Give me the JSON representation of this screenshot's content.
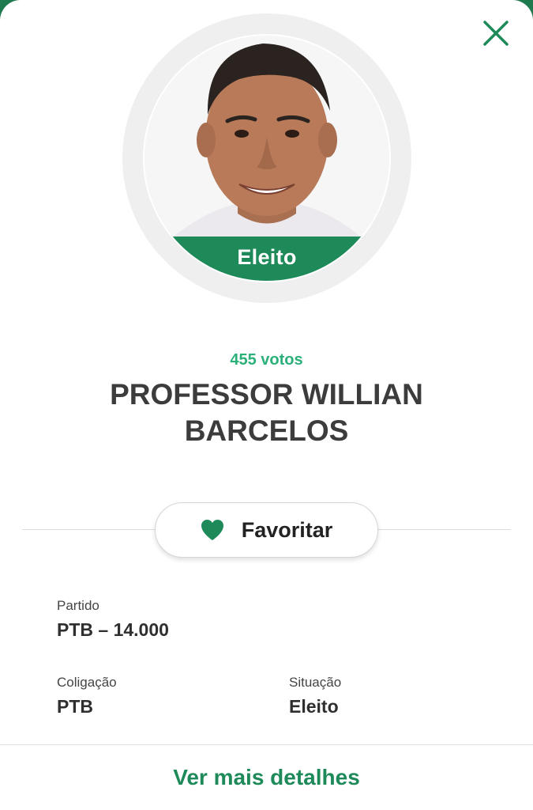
{
  "header": {
    "close_icon": "close-icon"
  },
  "candidate": {
    "status_badge": "Eleito",
    "votes": "455 votos",
    "name": "PROFESSOR WILLIAN BARCELOS"
  },
  "actions": {
    "favorite_label": "Favoritar",
    "favorite_icon": "heart-icon",
    "more_details_label": "Ver mais detalhes"
  },
  "details": {
    "party_label": "Partido",
    "party_value": "PTB – 14.000",
    "coalition_label": "Coligação",
    "coalition_value": "PTB",
    "situation_label": "Situação",
    "situation_value": "Eleito"
  },
  "colors": {
    "accent": "#1e8a5a",
    "votes": "#2bb07a",
    "text": "#3c3c3c"
  }
}
